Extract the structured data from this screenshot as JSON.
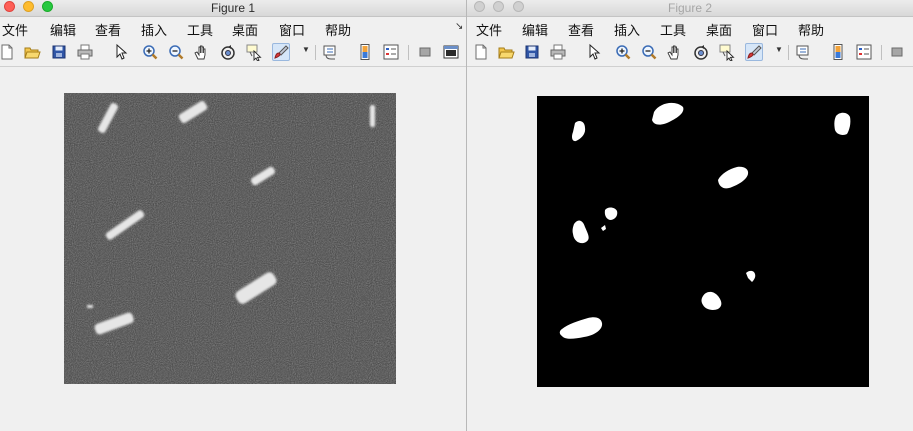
{
  "figure1": {
    "title": "Figure 1",
    "active": true,
    "traffic_light_colors": [
      "#fe5f57",
      "#febc2e",
      "#28c840"
    ],
    "menu": [
      "文件",
      "编辑",
      "查看",
      "插入",
      "工具",
      "桌面",
      "窗口",
      "帮助"
    ],
    "menu_expand_glyph": "↘",
    "image": {
      "content": "grayscale SAR image with ships",
      "background": "#3e3e3e"
    }
  },
  "figure2": {
    "title": "Figure 2",
    "active": false,
    "traffic_light_colors": [
      "#d0d0d0",
      "#d0d0d0",
      "#d0d0d0"
    ],
    "menu": [
      "文件",
      "编辑",
      "查看",
      "插入",
      "工具",
      "桌面",
      "窗口",
      "帮助"
    ],
    "image": {
      "content": "binary segmentation mask",
      "background": "#000000",
      "foreground": "#ffffff"
    }
  },
  "toolbar_icons": [
    "new-figure-icon",
    "open-file-icon",
    "save-icon",
    "print-icon",
    "edit-plot-pointer-icon",
    "zoom-in-icon",
    "zoom-out-icon",
    "pan-hand-icon",
    "rotate-3d-icon",
    "data-cursor-icon",
    "brush-icon",
    "link-plot-icon",
    "insert-colorbar-icon",
    "insert-legend-icon",
    "hide-plot-tools-icon",
    "show-plot-tools-icon"
  ]
}
